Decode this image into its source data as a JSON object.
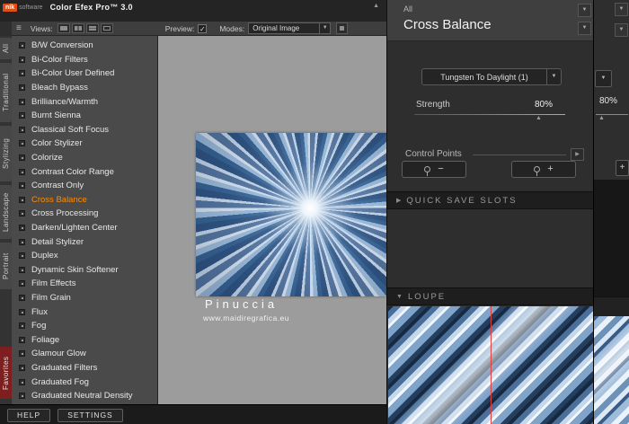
{
  "titlebar": {
    "logo_nik": "nik",
    "logo_software": "software",
    "title": "Color Efex Pro™ 3.0"
  },
  "toolbar": {
    "views_label": "Views:",
    "preview_label": "Preview:",
    "modes_label": "Modes:",
    "modes_value": "Original Image"
  },
  "tabs": [
    "All",
    "Traditional",
    "Stylizing",
    "Landscape",
    "Portrait",
    "Favorites"
  ],
  "filters": {
    "selected": "Cross Balance",
    "items": [
      "B/W Conversion",
      "Bi-Color Filters",
      "Bi-Color User Defined",
      "Bleach Bypass",
      "Brilliance/Warmth",
      "Burnt Sienna",
      "Classical Soft Focus",
      "Color Stylizer",
      "Colorize",
      "Contrast Color Range",
      "Contrast Only",
      "Cross Balance",
      "Cross Processing",
      "Darken/Lighten Center",
      "Detail Stylizer",
      "Duplex",
      "Dynamic Skin Softener",
      "Film Effects",
      "Film Grain",
      "Flux",
      "Fog",
      "Foliage",
      "Glamour Glow",
      "Graduated Filters",
      "Graduated Fog",
      "Graduated Neutral Density"
    ]
  },
  "canvas": {
    "caption_title": "Pinuccia",
    "caption_url": "www.maidiregrafica.eu"
  },
  "right_panel": {
    "category": "All",
    "title": "Cross Balance",
    "preset": "Tungsten To Daylight (1)",
    "strength_label": "Strength",
    "strength_value": "80%",
    "control_points_label": "Control Points",
    "cp_minus": "−",
    "cp_plus": "+",
    "quick_save_slots_label": "QUICK SAVE SLOTS",
    "loupe_label": "LOUPE"
  },
  "right_edge": {
    "strength_value": "80%",
    "cp_plus": "+"
  },
  "footer": {
    "help_label": "HELP",
    "settings_label": "SETTINGS"
  },
  "icons": {
    "chevron_down": "▼",
    "triangle_right": "▶",
    "triangle_up": "▲",
    "check": "✓",
    "menu": "≡"
  },
  "colors": {
    "accent": "#ff8a00",
    "favorites_red": "#7d1f1f",
    "loupe_line": "#e04040",
    "canvas_gray": "#9c9c9c"
  }
}
